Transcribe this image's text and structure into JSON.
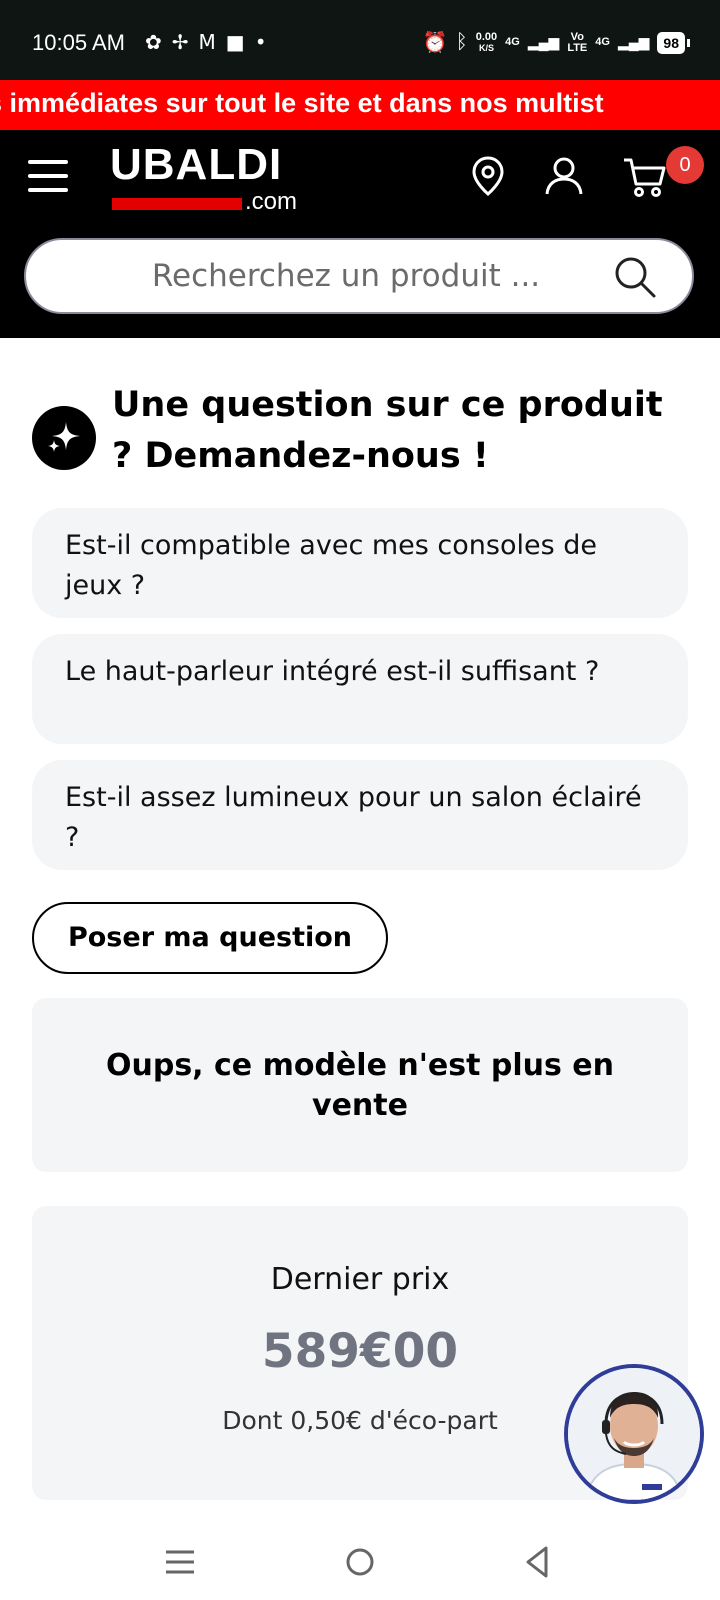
{
  "status_bar": {
    "time": "10:05 AM",
    "net_speed_value": "0.00",
    "net_speed_unit": "K/S",
    "signal_1": "4G",
    "signal_2_top": "Vo",
    "signal_2_bottom": "LTE",
    "signal_3": "4G",
    "battery": "98"
  },
  "promo_banner": {
    "text": "es immédiates sur tout le site et dans nos multist"
  },
  "header": {
    "logo_text": "UBALDI",
    "logo_domain": ".com",
    "cart_count": "0",
    "icons": [
      "menu-icon",
      "location-pin-icon",
      "user-icon",
      "cart-icon"
    ]
  },
  "search": {
    "placeholder": "Recherchez un produit ..."
  },
  "qa": {
    "title": "Une question sur ce produit ? Demandez-nous !",
    "questions": [
      "Est-il compatible avec mes consoles de jeux ?",
      "Le haut-parleur intégré est-il suffisant ?",
      "Est-il assez lumineux pour un salon éclairé ?"
    ],
    "ask_button": "Poser ma question"
  },
  "availability": {
    "message": "Oups, ce modèle n'est plus en vente"
  },
  "price": {
    "label": "Dernier prix",
    "value": "589€00",
    "eco_part": "Dont 0,50€ d'éco-part"
  },
  "colors": {
    "accent_red": "#ff0000",
    "header_bg": "#000000",
    "card_bg": "#f4f5f7",
    "price_gray": "#707480",
    "badge_red": "#e53935",
    "avatar_ring": "#2f3d99"
  }
}
